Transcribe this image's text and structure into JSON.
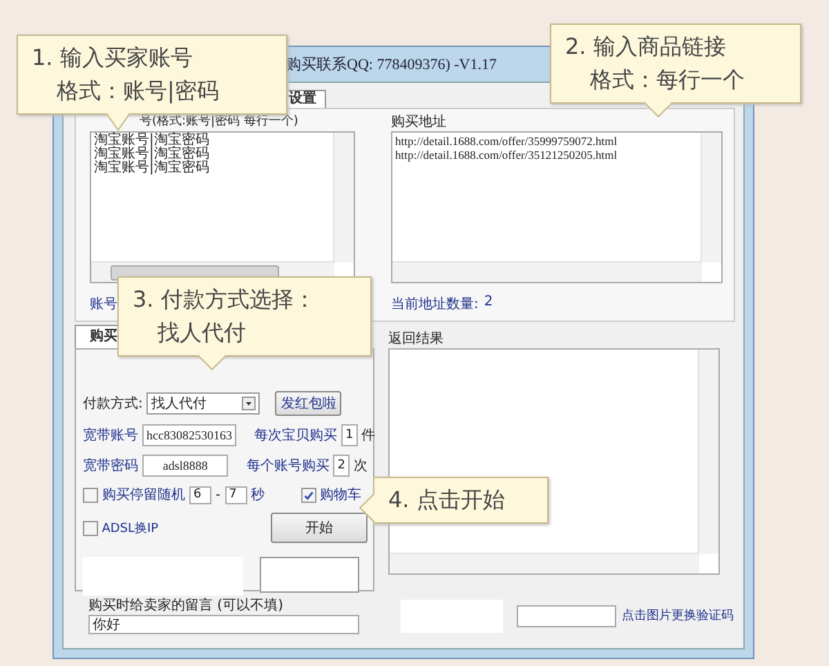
{
  "window": {
    "title": "购买联系QQ: 778409376) -V1.17"
  },
  "top_tabs": [
    {
      "label": "设置",
      "selected": true
    }
  ],
  "accounts": {
    "label": "号(格式:账号|密码 每行一个)",
    "lines": [
      "淘宝账号|淘宝密码",
      "淘宝账号|淘宝密码",
      "淘宝账号|淘宝密码"
    ],
    "footer": "账号"
  },
  "urls": {
    "label": "购买地址",
    "lines": [
      "http://detail.1688.com/offer/35999759072.html",
      "http://detail.1688.com/offer/35121250205.html"
    ],
    "count_label": "当前地址数量:",
    "count": "2"
  },
  "purchase_tab": {
    "label": "购买",
    "selected": true
  },
  "payment": {
    "label": "付款方式:",
    "value": "找人代付"
  },
  "red_packet_button": "发红包啦",
  "fields": [
    {
      "label": "宽带账号",
      "value": "hcc83082530163"
    },
    {
      "label": "宽带密码",
      "value": "adsl8888"
    }
  ],
  "per_item": {
    "label": "每次宝贝购买",
    "value": "1",
    "unit": "件"
  },
  "per_account": {
    "label": "每个账号购买",
    "value": "2",
    "unit": "次"
  },
  "random_stay": {
    "label": "购买停留随机",
    "checked": false,
    "from": "6",
    "sep": "-",
    "to": "7",
    "unit": "秒"
  },
  "cart": {
    "label": "购物车",
    "checked": true
  },
  "adsl": {
    "label": "ADSL换IP",
    "checked": false
  },
  "start_button": "开始",
  "message": {
    "label": "购买时给卖家的留言 (可以不填)",
    "value": "你好"
  },
  "results": {
    "label": "返回结果"
  },
  "captcha": {
    "link": "点击图片更换验证码"
  },
  "callouts": [
    {
      "lines": [
        "1. 输入买家账号",
        "格式：账号|密码"
      ]
    },
    {
      "lines": [
        "2. 输入商品链接",
        "格式：每行一个"
      ]
    },
    {
      "lines": [
        "3. 付款方式选择：",
        "找人代付"
      ]
    },
    {
      "lines": [
        "4. 点击开始"
      ]
    }
  ]
}
